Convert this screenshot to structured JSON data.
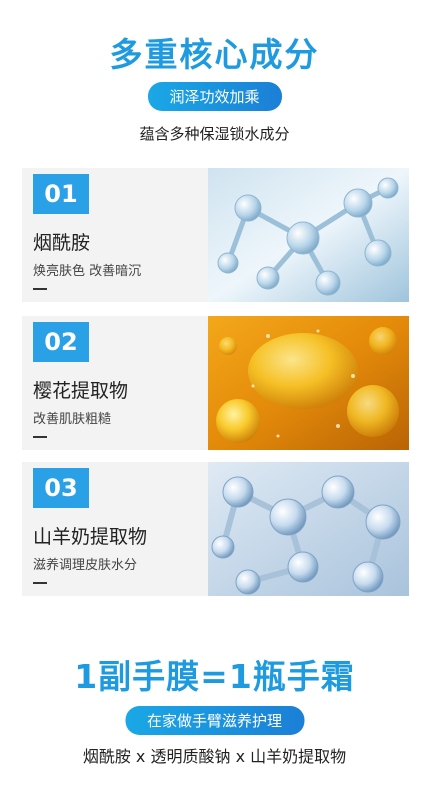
{
  "header": {
    "title": "多重核心成分",
    "pill": "润泽功效加乘",
    "intro": "蕴含多种保湿锁水成分"
  },
  "ingredients": [
    {
      "number": "01",
      "name": "烟酰胺",
      "desc": "焕亮肤色 改善暗沉",
      "image": "molecule-blue-image"
    },
    {
      "number": "02",
      "name": "樱花提取物",
      "desc": "改善肌肤粗糙",
      "image": "golden-oil-drops-image"
    },
    {
      "number": "03",
      "name": "山羊奶提取物",
      "desc": "滋养调理皮肤水分",
      "image": "molecule-crystal-image"
    }
  ],
  "bottom": {
    "slogan": "1副手膜=1瓶手霜",
    "pill": "在家做手臂滋养护理",
    "footer": "烟酰胺 x 透明质酸钠 x 山羊奶提取物"
  },
  "colors": {
    "accent": "#1e9be0",
    "badge": "#2aa1e6",
    "card_bg": "#f3f3f3"
  }
}
